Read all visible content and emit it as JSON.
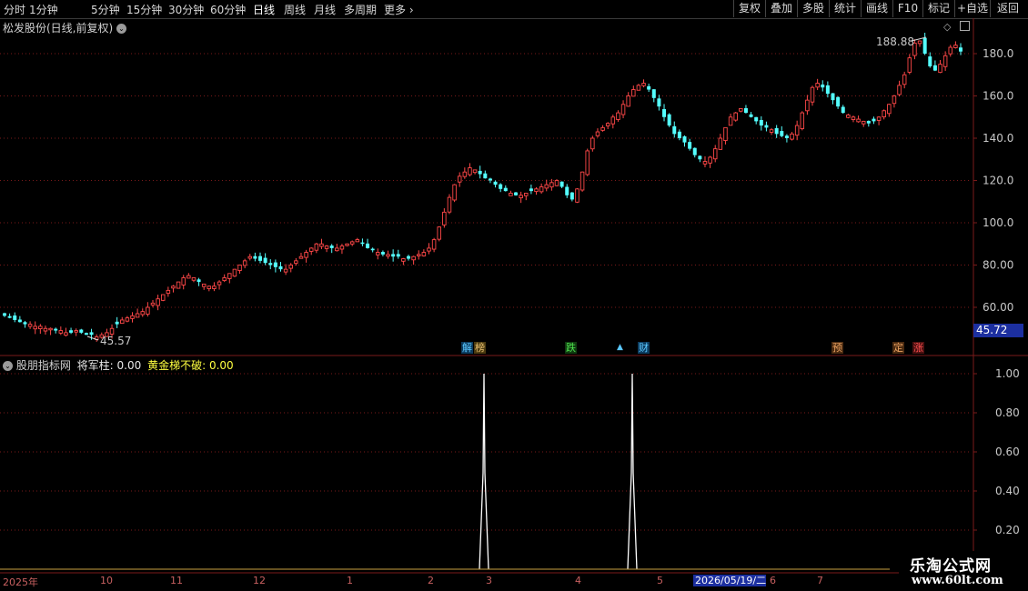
{
  "toolbar": {
    "periods": [
      "分时",
      "1分钟",
      "5分钟",
      "15分钟",
      "30分钟",
      "60分钟",
      "日线",
      "周线",
      "月线",
      "多周期"
    ],
    "more_label": "更多",
    "active_period": "日线",
    "tools": [
      "复权",
      "叠加",
      "多股",
      "统计",
      "画线",
      "F10",
      "标记",
      "+自选",
      "返回"
    ]
  },
  "stock": {
    "title": "松发股份(日线,前复权)",
    "high_label": "188.88",
    "low_label": "45.57",
    "current_price": "45.72"
  },
  "indicator": {
    "name": "股朋指标网",
    "field1_label": "将军柱:",
    "field1_value": "0.00",
    "field2_label": "黄金梯不破:",
    "field2_value": "0.00"
  },
  "price_axis": [
    "180.0",
    "160.0",
    "140.0",
    "120.0",
    "100.0",
    "80.00",
    "60.00"
  ],
  "indicator_axis": [
    "1.00",
    "0.80",
    "0.60",
    "0.40",
    "0.20"
  ],
  "events": [
    {
      "label": "解",
      "color": "#5bc8ff"
    },
    {
      "label": "榜",
      "color": "#e8c070"
    },
    {
      "label": "跌",
      "color": "#4ee04e"
    },
    {
      "label": "财",
      "color": "#5bc8ff"
    },
    {
      "label": "预",
      "color": "#e8a060"
    },
    {
      "label": "定",
      "color": "#e8a060"
    },
    {
      "label": "涨",
      "color": "#ff5050"
    }
  ],
  "date_axis": [
    "2025年",
    "10",
    "11",
    "12",
    "1",
    "2",
    "3",
    "4",
    "5",
    "6",
    "7"
  ],
  "date_cursor": "2026/05/19/二",
  "watermark": {
    "line1": "乐淘公式网",
    "line2": "www.60lt.com"
  },
  "colors": {
    "up": "#ff4848",
    "down": "#54ffff",
    "grid": "#7a1a1a",
    "accent": "#1c2fa0"
  },
  "chart_data": {
    "type": "candlestick",
    "ylim": [
      40,
      195
    ],
    "closes": [
      56,
      55,
      54,
      53,
      52,
      52,
      51,
      51,
      50,
      50,
      49,
      49,
      48,
      48,
      49,
      48,
      47,
      47,
      46,
      47,
      48,
      50,
      52,
      54,
      55,
      56,
      57,
      58,
      60,
      62,
      64,
      66,
      68,
      70,
      72,
      74,
      75,
      74,
      72,
      71,
      70,
      70,
      72,
      74,
      76,
      78,
      80,
      82,
      84,
      83,
      82,
      81,
      80,
      79,
      78,
      78,
      80,
      82,
      84,
      86,
      88,
      90,
      90,
      89,
      88,
      88,
      89,
      90,
      91,
      92,
      90,
      88,
      87,
      86,
      85,
      85,
      84,
      84,
      83,
      83,
      84,
      85,
      86,
      88,
      92,
      98,
      105,
      112,
      118,
      122,
      124,
      126,
      125,
      123,
      121,
      120,
      118,
      116,
      115,
      114,
      113,
      113,
      114,
      115,
      116,
      117,
      118,
      119,
      120,
      117,
      113,
      111,
      116,
      124,
      134,
      140,
      143,
      145,
      147,
      150,
      152,
      156,
      160,
      163,
      165,
      166,
      163,
      159,
      155,
      150,
      146,
      142,
      140,
      138,
      135,
      132,
      130,
      129,
      131,
      135,
      140,
      145,
      150,
      152,
      154,
      152,
      150,
      148,
      146,
      145,
      144,
      142,
      141,
      140,
      142,
      146,
      152,
      158,
      164,
      166,
      164,
      161,
      158,
      155,
      152,
      151,
      150,
      149,
      148,
      147,
      148,
      150,
      153,
      156,
      160,
      165,
      170,
      178,
      185,
      186,
      180,
      174,
      172,
      175,
      179,
      183,
      184,
      181
    ]
  }
}
